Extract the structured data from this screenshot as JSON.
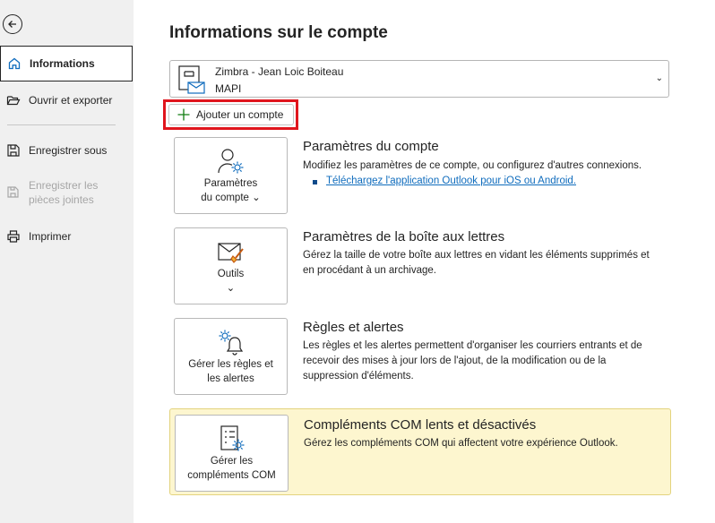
{
  "sidebar": {
    "back_label": "Retour",
    "items": [
      {
        "label": "Informations",
        "icon": "home-icon",
        "active": true
      },
      {
        "label": "Ouvrir et exporter",
        "icon": "folder-open-icon"
      },
      {
        "label": "Enregistrer sous",
        "icon": "save-as-icon"
      },
      {
        "label_line1": "Enregistrer les",
        "label_line2": "pièces jointes",
        "icon": "save-attachments-icon",
        "disabled": true
      },
      {
        "label": "Imprimer",
        "icon": "printer-icon"
      }
    ]
  },
  "main": {
    "title": "Informations sur le compte",
    "account": {
      "name": "Zimbra - Jean Loic Boiteau",
      "type": "MAPI",
      "icon": "mailbox-icon"
    },
    "add_account_label": "Ajouter un compte",
    "sections": [
      {
        "tile_line1": "Paramètres",
        "tile_line2": "du compte",
        "tile_chevron": "⌄",
        "title": "Paramètres du compte",
        "description": "Modifiez les paramètres de ce compte, ou configurez d'autres connexions.",
        "link": "Téléchargez l'application Outlook pour iOS ou Android."
      },
      {
        "tile_line1": "Outils",
        "tile_chevron": "⌄",
        "title": "Paramètres de la boîte aux lettres",
        "description_line1": "Gérez la taille de votre boîte aux lettres en vidant les éléments supprimés et",
        "description_line2": "en procédant à un archivage."
      },
      {
        "tile_line1": "Gérer les règles et",
        "tile_line2": "les alertes",
        "title": "Règles et alertes",
        "description_line1": "Les règles et les alertes permettent d'organiser les courriers entrants et de",
        "description_line2": "recevoir des mises à jour lors de l'ajout, de la modification ou de la",
        "description_line3": "suppression d'éléments."
      },
      {
        "tile_line1": "Gérer les",
        "tile_line2": "compléments COM",
        "title": "Compléments COM lents et désactivés",
        "description": "Gérez les compléments COM qui affectent votre expérience Outlook."
      }
    ]
  },
  "colors": {
    "accent": "#0f6cbd",
    "highlight_border": "#e0151d",
    "warning_bg": "#fdf6cf"
  }
}
